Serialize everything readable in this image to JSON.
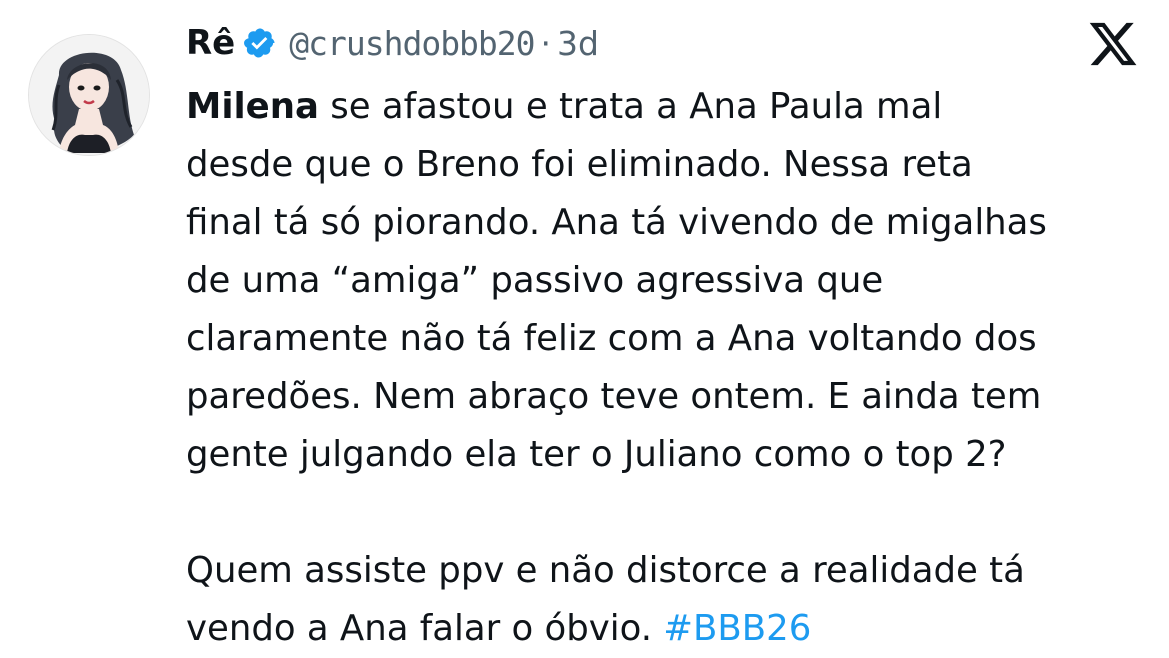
{
  "author": {
    "display_name": "Rê",
    "handle": "@crushdobbb20",
    "separator": "·",
    "timestamp": "3d",
    "verified": true,
    "verified_color": "#1d9bf0",
    "avatar_icon": "illustrated-woman-avatar"
  },
  "platform": {
    "logo_icon": "x-logo",
    "logo_color": "#0f1419"
  },
  "tweet": {
    "bold_name": "Milena",
    "line1_rest": " se afastou e trata a Ana Paula mal",
    "line2": "desde que o Breno foi eliminado. Nessa reta",
    "line3": "final tá só piorando. Ana tá vivendo de migalhas",
    "line4": "de uma “amiga” passivo agressiva que",
    "line5": "claramente não tá feliz com a Ana voltando dos",
    "line6": "paredões. Nem abraço teve ontem. E ainda tem",
    "line7": "gente julgando ela ter o Juliano como o top 2?",
    "line8": "Quem assiste ppv e não distorce a realidade tá",
    "line9_text": "vendo a Ana falar o óbvio. ",
    "hashtag": "#BBB26",
    "hashtag_color": "#1d9bf0"
  }
}
